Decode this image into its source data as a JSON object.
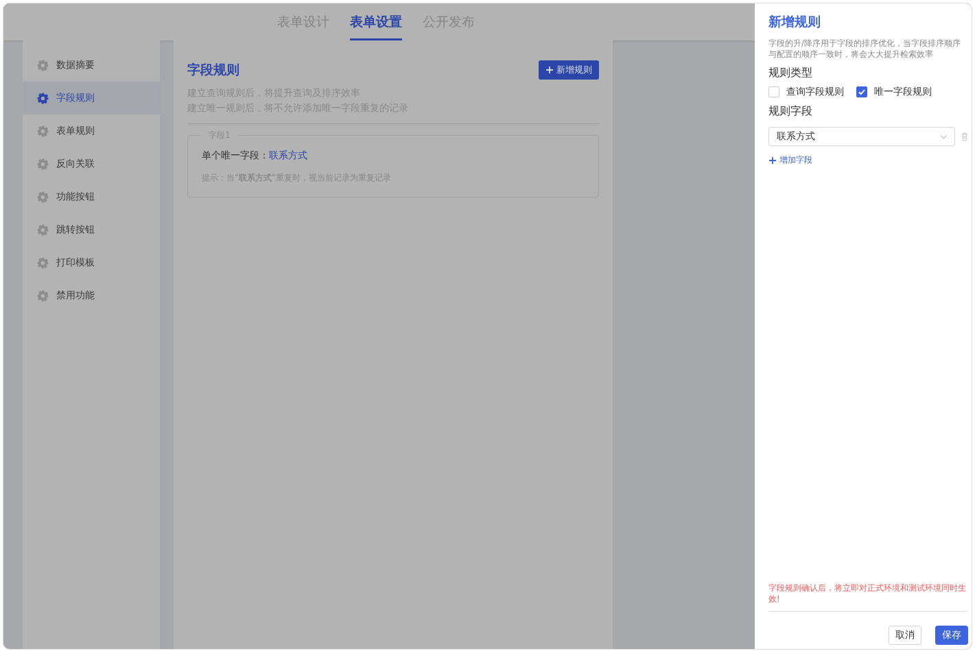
{
  "tabs": [
    {
      "label": "表单设计",
      "selected": false
    },
    {
      "label": "表单设置",
      "selected": true
    },
    {
      "label": "公开发布",
      "selected": false
    }
  ],
  "sidebar": {
    "items": [
      {
        "label": "数据摘要",
        "selected": false
      },
      {
        "label": "字段规则",
        "selected": true
      },
      {
        "label": "表单规则",
        "selected": false
      },
      {
        "label": "反向关联",
        "selected": false
      },
      {
        "label": "功能按钮",
        "selected": false
      },
      {
        "label": "跳转按钮",
        "selected": false
      },
      {
        "label": "打印模板",
        "selected": false
      },
      {
        "label": "禁用功能",
        "selected": false
      }
    ]
  },
  "content": {
    "title": "字段规则",
    "add_button": "新增规则",
    "descriptions": [
      "建立查询规则后，将提升查询及排序效率",
      "建立唯一规则后，将不允许添加唯一字段重复的记录"
    ],
    "rules": [
      {
        "legend": "字段1",
        "label": "单个唯一字段：",
        "value": "联系方式",
        "hint": "提示：当“**联系方式**”重复时，视当前记录为重复记录"
      }
    ]
  },
  "drawer": {
    "title": "新增规则",
    "description": "字段的升/降序用于字段的排序优化，当字段排序顺序与配置的顺序一致时，将会大大提升检索效率",
    "type_label": "规则类型",
    "types": [
      {
        "label": "查询字段规则",
        "checked": false
      },
      {
        "label": "唯一字段规则",
        "checked": true
      }
    ],
    "fields_label": "规则字段",
    "fields": [
      {
        "value": "联系方式"
      }
    ],
    "add_field": "增加字段",
    "warning": "字段规则确认后，将立即对正式环境和测试环境同时生效!",
    "cancel": "取消",
    "save": "保存"
  }
}
